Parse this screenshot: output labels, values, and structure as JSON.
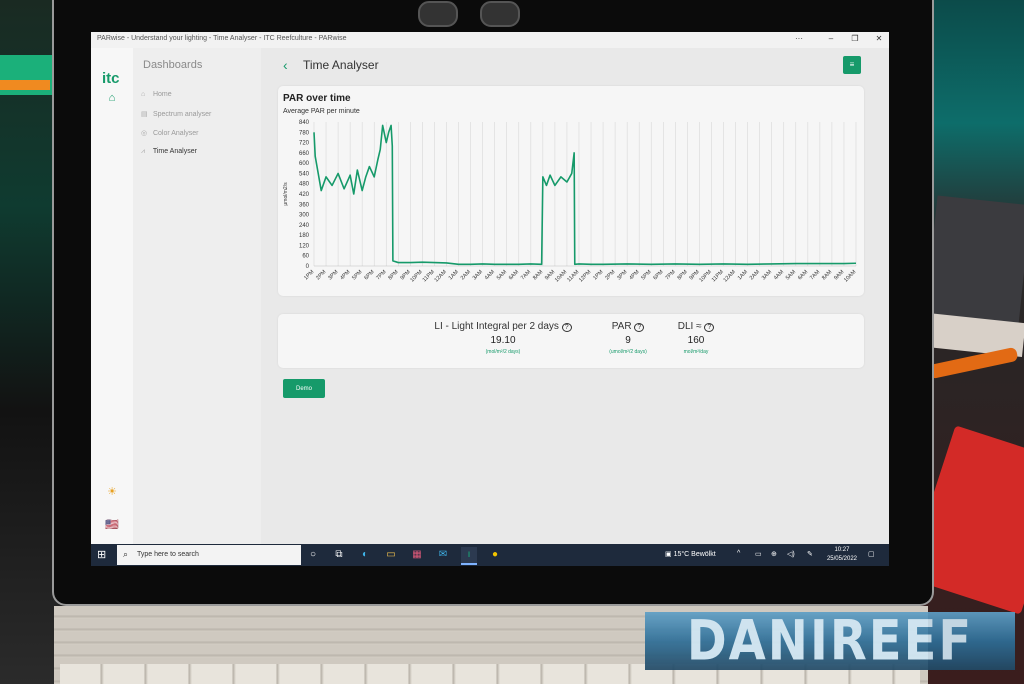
{
  "window": {
    "title": "PARwise - Understand your lighting - Time Analyser - ITC Reefculture - PARwise",
    "more_label": "···",
    "minimize_label": "–",
    "maximize_label": "❐",
    "close_label": "✕"
  },
  "app": {
    "logo": "itc"
  },
  "sidebar": {
    "title": "Dashboards",
    "items": [
      {
        "label": "Home",
        "icon": "home-icon",
        "active": false
      },
      {
        "label": "Spectrum analyser",
        "icon": "spectrum-icon",
        "active": false
      },
      {
        "label": "Color Analyser",
        "icon": "palette-icon",
        "active": false
      },
      {
        "label": "Time Analyser",
        "icon": "line-chart-icon",
        "active": true
      }
    ]
  },
  "rail": {
    "home_icon": "⌂",
    "theme_icon": "☀",
    "language_icon": "🇺🇸"
  },
  "header": {
    "back_label": "‹",
    "title": "Time Analyser",
    "menu_label": "≡"
  },
  "chart_card": {
    "title": "PAR over time",
    "subtitle": "Average PAR per minute"
  },
  "chart_data": {
    "type": "line",
    "title": "PAR over time",
    "subtitle": "Average PAR per minute",
    "ylabel": "μmol/m2/s",
    "xlabel": "",
    "ylim": [
      0,
      840
    ],
    "yticks": [
      0,
      60,
      120,
      180,
      240,
      300,
      360,
      420,
      480,
      540,
      600,
      660,
      720,
      780,
      840
    ],
    "categories": [
      "1PM",
      "2PM",
      "3PM",
      "4PM",
      "5PM",
      "6PM",
      "7PM",
      "8PM",
      "9PM",
      "10PM",
      "11PM",
      "12AM",
      "1AM",
      "2AM",
      "3AM",
      "4AM",
      "5AM",
      "6AM",
      "7AM",
      "8AM",
      "9AM",
      "10AM",
      "11AM",
      "12PM",
      "1PM",
      "2PM",
      "3PM",
      "4PM",
      "5PM",
      "6PM",
      "7PM",
      "8PM",
      "9PM",
      "10PM",
      "11PM",
      "12AM",
      "1AM",
      "2AM",
      "3AM",
      "4AM",
      "5AM",
      "6AM",
      "7AM",
      "8AM",
      "9AM",
      "10AM"
    ],
    "x": [
      0,
      0.1,
      0.3,
      0.6,
      1,
      1.5,
      2,
      2.5,
      3,
      3.3,
      3.6,
      4,
      4.3,
      4.6,
      5,
      5.3,
      5.5,
      5.7,
      6,
      6.2,
      6.4,
      6.5,
      6.55,
      7,
      8,
      9,
      10,
      11,
      12,
      13,
      14,
      15,
      16,
      17,
      18,
      18.9,
      19,
      19.3,
      19.6,
      20,
      20.5,
      21,
      21.4,
      21.6,
      21.65,
      22,
      23,
      24,
      26,
      28,
      30,
      32,
      34,
      36,
      38,
      40,
      42,
      44,
      45
    ],
    "series": [
      {
        "values": [
          780,
          640,
          560,
          440,
          520,
          470,
          540,
          450,
          530,
          420,
          560,
          440,
          520,
          580,
          520,
          620,
          680,
          820,
          720,
          780,
          820,
          700,
          30,
          20,
          20,
          22,
          20,
          18,
          10,
          10,
          12,
          10,
          10,
          10,
          12,
          10,
          520,
          470,
          530,
          470,
          520,
          490,
          540,
          660,
          10,
          12,
          10,
          10,
          12,
          10,
          12,
          10,
          12,
          10,
          12,
          14,
          14,
          14,
          16
        ]
      }
    ],
    "grid": true,
    "color": "#169a6a"
  },
  "metrics": [
    {
      "label": "LI - Light Integral per 2 days",
      "help_icon": "?",
      "value": "19.10",
      "unit": "(mol/m²/2 days)"
    },
    {
      "label": "PAR",
      "help_icon": "?",
      "value": "9",
      "unit": "(umol/m²/2 days)"
    },
    {
      "label": "DLI ≈",
      "help_icon": "?",
      "value": "160",
      "unit": "mol/m²/day"
    }
  ],
  "demo_button": "Demo",
  "taskbar": {
    "search_placeholder": "Type here to search",
    "weather": "15°C  Bewölkt",
    "time": "10:27",
    "date": "25/05/2022"
  },
  "watermark": "DANIREEF",
  "colors": {
    "accent": "#169a6a",
    "taskbar": "#1e2a3c"
  }
}
